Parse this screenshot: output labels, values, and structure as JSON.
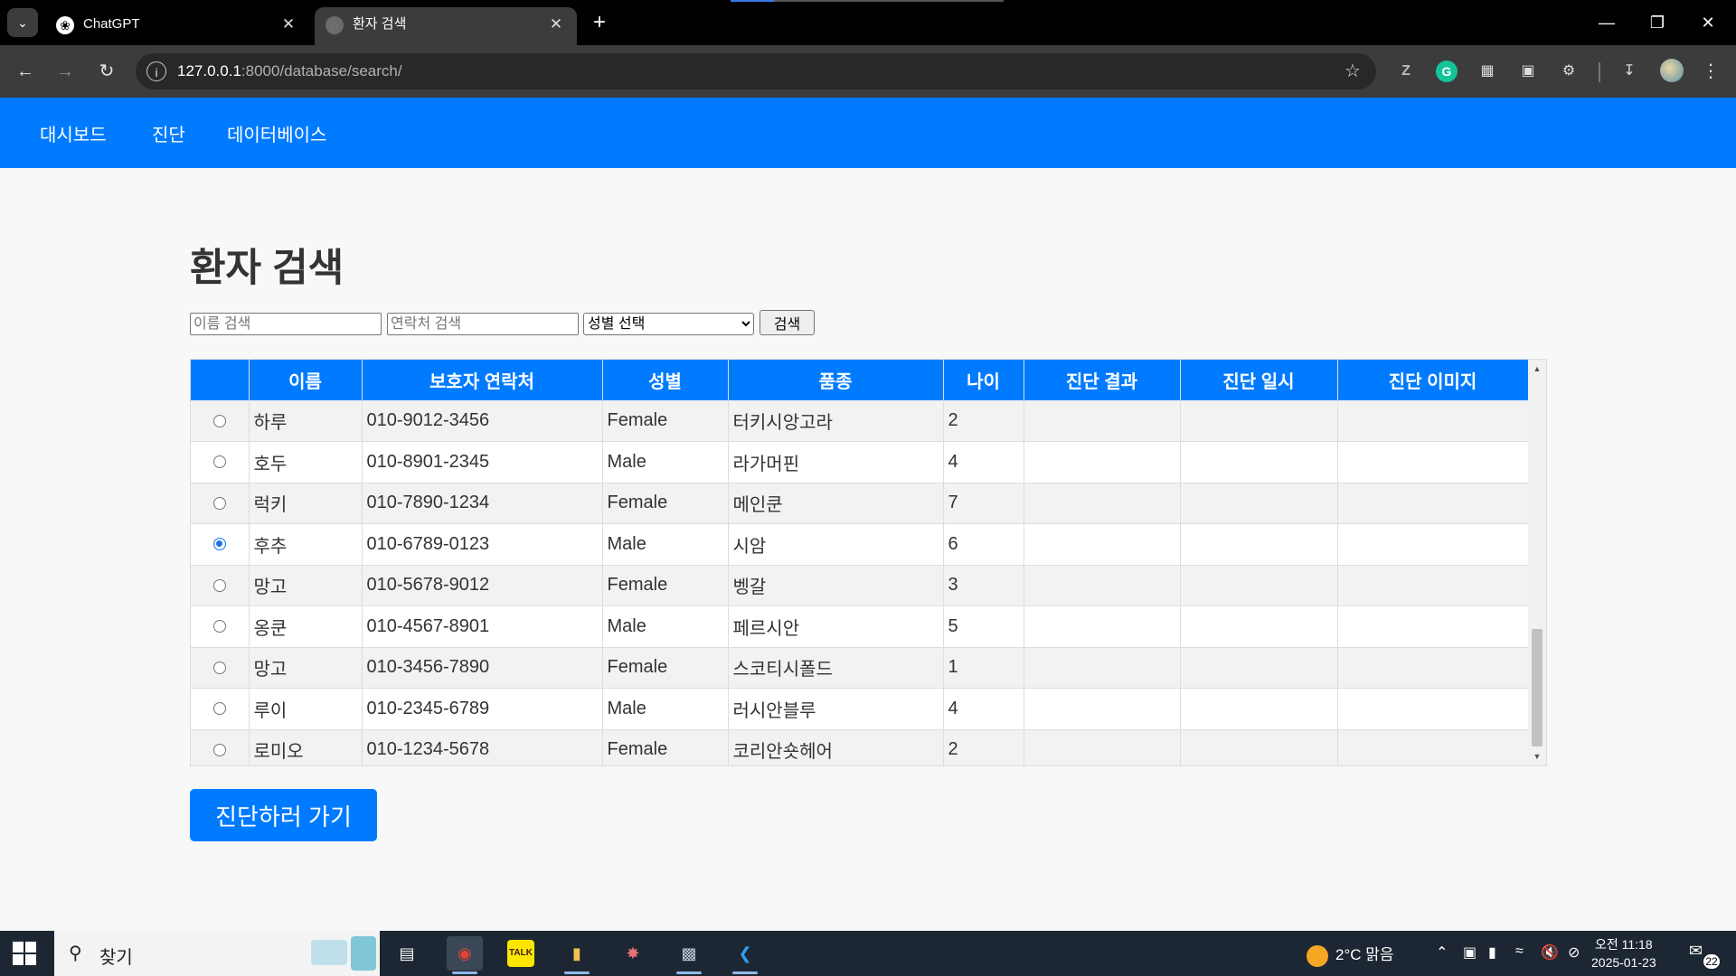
{
  "browser": {
    "tabs": [
      {
        "title": "ChatGPT",
        "favicon": "chatgpt-icon",
        "active": false
      },
      {
        "title": "환자 검색",
        "favicon": "loading-icon",
        "active": true
      }
    ],
    "address": {
      "host": "127.0.0.1",
      "path": ":8000/database/search/"
    },
    "page_load_progress": 0.16
  },
  "nav": {
    "items": [
      "대시보드",
      "진단",
      "데이터베이스"
    ]
  },
  "page": {
    "title": "환자 검색"
  },
  "search": {
    "name_placeholder": "이름 검색",
    "phone_placeholder": "연락처 검색",
    "gender_selected": "성별 선택",
    "button_label": "검색"
  },
  "table": {
    "headers": [
      "",
      "이름",
      "보호자 연락처",
      "성별",
      "품종",
      "나이",
      "진단 결과",
      "진단 일시",
      "진단 이미지"
    ],
    "rows": [
      {
        "selected": false,
        "name": "하루",
        "phone": "010-9012-3456",
        "gender": "Female",
        "breed": "터키시앙고라",
        "age": "2",
        "result": "",
        "date": "",
        "image": ""
      },
      {
        "selected": false,
        "name": "호두",
        "phone": "010-8901-2345",
        "gender": "Male",
        "breed": "라가머핀",
        "age": "4",
        "result": "",
        "date": "",
        "image": ""
      },
      {
        "selected": false,
        "name": "럭키",
        "phone": "010-7890-1234",
        "gender": "Female",
        "breed": "메인쿤",
        "age": "7",
        "result": "",
        "date": "",
        "image": ""
      },
      {
        "selected": true,
        "name": "후추",
        "phone": "010-6789-0123",
        "gender": "Male",
        "breed": "시암",
        "age": "6",
        "result": "",
        "date": "",
        "image": ""
      },
      {
        "selected": false,
        "name": "망고",
        "phone": "010-5678-9012",
        "gender": "Female",
        "breed": "벵갈",
        "age": "3",
        "result": "",
        "date": "",
        "image": ""
      },
      {
        "selected": false,
        "name": "옹쿤",
        "phone": "010-4567-8901",
        "gender": "Male",
        "breed": "페르시안",
        "age": "5",
        "result": "",
        "date": "",
        "image": ""
      },
      {
        "selected": false,
        "name": "망고",
        "phone": "010-3456-7890",
        "gender": "Female",
        "breed": "스코티시폴드",
        "age": "1",
        "result": "",
        "date": "",
        "image": ""
      },
      {
        "selected": false,
        "name": "루이",
        "phone": "010-2345-6789",
        "gender": "Male",
        "breed": "러시안블루",
        "age": "4",
        "result": "",
        "date": "",
        "image": ""
      },
      {
        "selected": false,
        "name": "로미오",
        "phone": "010-1234-5678",
        "gender": "Female",
        "breed": "코리안숏헤어",
        "age": "2",
        "result": "",
        "date": "",
        "image": ""
      }
    ]
  },
  "action": {
    "button_label": "진단하러 가기"
  },
  "taskbar": {
    "search_label": "찾기",
    "weather": "2°C  맑음",
    "time": "오전 11:18",
    "date": "2025-01-23",
    "notification_count": "22"
  },
  "colors": {
    "accent": "#007bff",
    "row_alt": "#f2f2f2"
  }
}
